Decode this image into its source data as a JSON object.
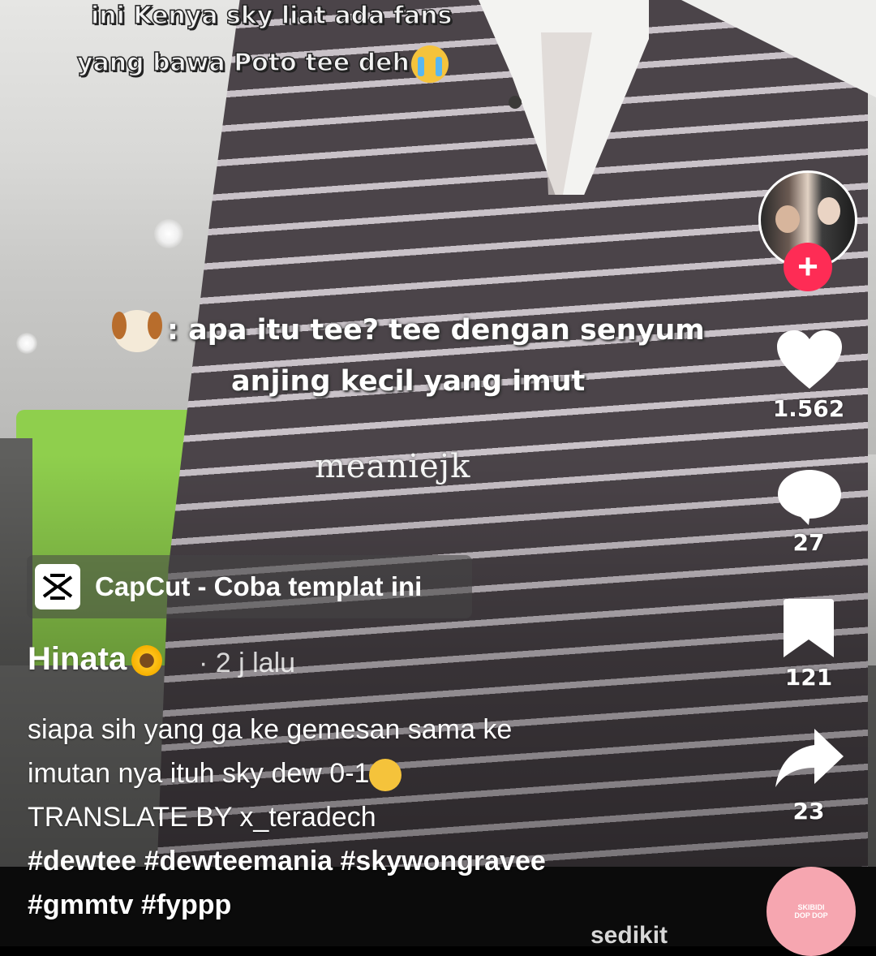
{
  "overlay": {
    "top_caption_line1": "ini Kenya sky liat ada fans",
    "top_caption_line2": "yang bawa Poto tee deh",
    "mid_caption_line1": ": apa itu tee? tee dengan senyum",
    "mid_caption_line2": "anjing kecil yang imut",
    "watermark": "meaniejk"
  },
  "actions": {
    "follow_label": "+",
    "likes": "1.562",
    "comments": "27",
    "bookmarks": "121",
    "shares": "23"
  },
  "capcut": {
    "label": "CapCut - Coba templat ini"
  },
  "post": {
    "author": "Hinata",
    "time": "· 2 j lalu",
    "desc_line1": "siapa sih yang ga ke gemesan sama ke",
    "desc_line2": "imutan nya ituh sky dew 0-1",
    "desc_line3": "TRANSLATE BY x_teradech",
    "tags_line1": "#dewtee #dewteemania #skywongravee",
    "tags_line2": "#gmmtv #fyppp"
  },
  "music": {
    "disc_text_line1": "SKIBIDI",
    "disc_text_line2": "DOP DOP"
  },
  "below": {
    "partial_text": "sedikit"
  },
  "colors": {
    "follow_red": "#fe2c55",
    "icon_white": "#ffffff",
    "green_panel": "#8fcf4d"
  },
  "icons": [
    "heart-icon",
    "comment-icon",
    "bookmark-icon",
    "share-icon",
    "capcut-logo-icon",
    "sunflower-emoji",
    "crying-emoji",
    "dog-emoji",
    "upside-down-smile-emoji"
  ]
}
